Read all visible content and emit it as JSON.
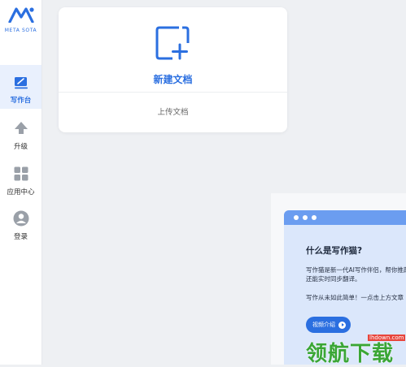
{
  "logo": {
    "text": "META SOTA"
  },
  "nav": {
    "items": [
      {
        "label": "写作台",
        "icon": "write-icon",
        "active": true
      },
      {
        "label": "升级",
        "icon": "upload-arrow-icon",
        "active": false
      },
      {
        "label": "应用中心",
        "icon": "apps-grid-icon",
        "active": false
      },
      {
        "label": "登录",
        "icon": "user-icon",
        "active": false
      }
    ]
  },
  "card": {
    "new_doc_label": "新建文档",
    "upload_label": "上传文档"
  },
  "promo": {
    "title": "什么是写作猫?",
    "line1": "写作猫是新一代AI写作伴侣，帮你推敲",
    "line2": "还能实时同步翻译。",
    "line3": "写作从未如此简单！一点击上方文章",
    "button_label": "视频介绍"
  },
  "watermark": {
    "url": "lhdown.com",
    "text": "领航下载"
  },
  "colors": {
    "accent": "#2b6fe0",
    "background": "#eef0f3",
    "promo_bg": "#dbe7fb",
    "promo_bar": "#6b9df0"
  }
}
